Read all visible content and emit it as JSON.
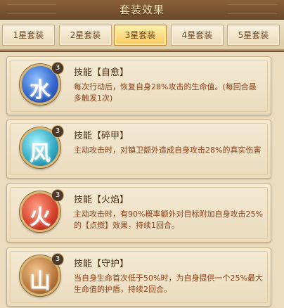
{
  "window": {
    "title": "套装效果"
  },
  "tabs": [
    {
      "label": "1星套装",
      "active": false
    },
    {
      "label": "2星套装",
      "active": false
    },
    {
      "label": "3星套装",
      "active": true
    },
    {
      "label": "4星套装",
      "active": false
    },
    {
      "label": "5星套装",
      "active": false
    }
  ],
  "skills": [
    {
      "glyph": "水",
      "level": "3",
      "title": "技能【自愈】",
      "desc": "每次行动后，恢复自身28%攻击的生命值。(每回合最多触发1次)"
    },
    {
      "glyph": "风",
      "level": "3",
      "title": "技能【碎甲】",
      "desc": "主动攻击时，对镇卫额外造成自身攻击28%的真实伤害"
    },
    {
      "glyph": "火",
      "level": "3",
      "title": "技能【火焰】",
      "desc": "主动攻击时，有90%概率额外对目标附加自身攻击25%的【点燃】效果，持续1回合。"
    },
    {
      "glyph": "山",
      "level": "3",
      "title": "技能【守护】",
      "desc": "当自身生命首次低于50%时，为自身提供一个25%最大生命值的护盾，持续2回合。"
    }
  ],
  "colors": {
    "active_tab": "#f7c85a",
    "desc_text": "#8a3e14",
    "title_text": "#ffe9b8"
  }
}
